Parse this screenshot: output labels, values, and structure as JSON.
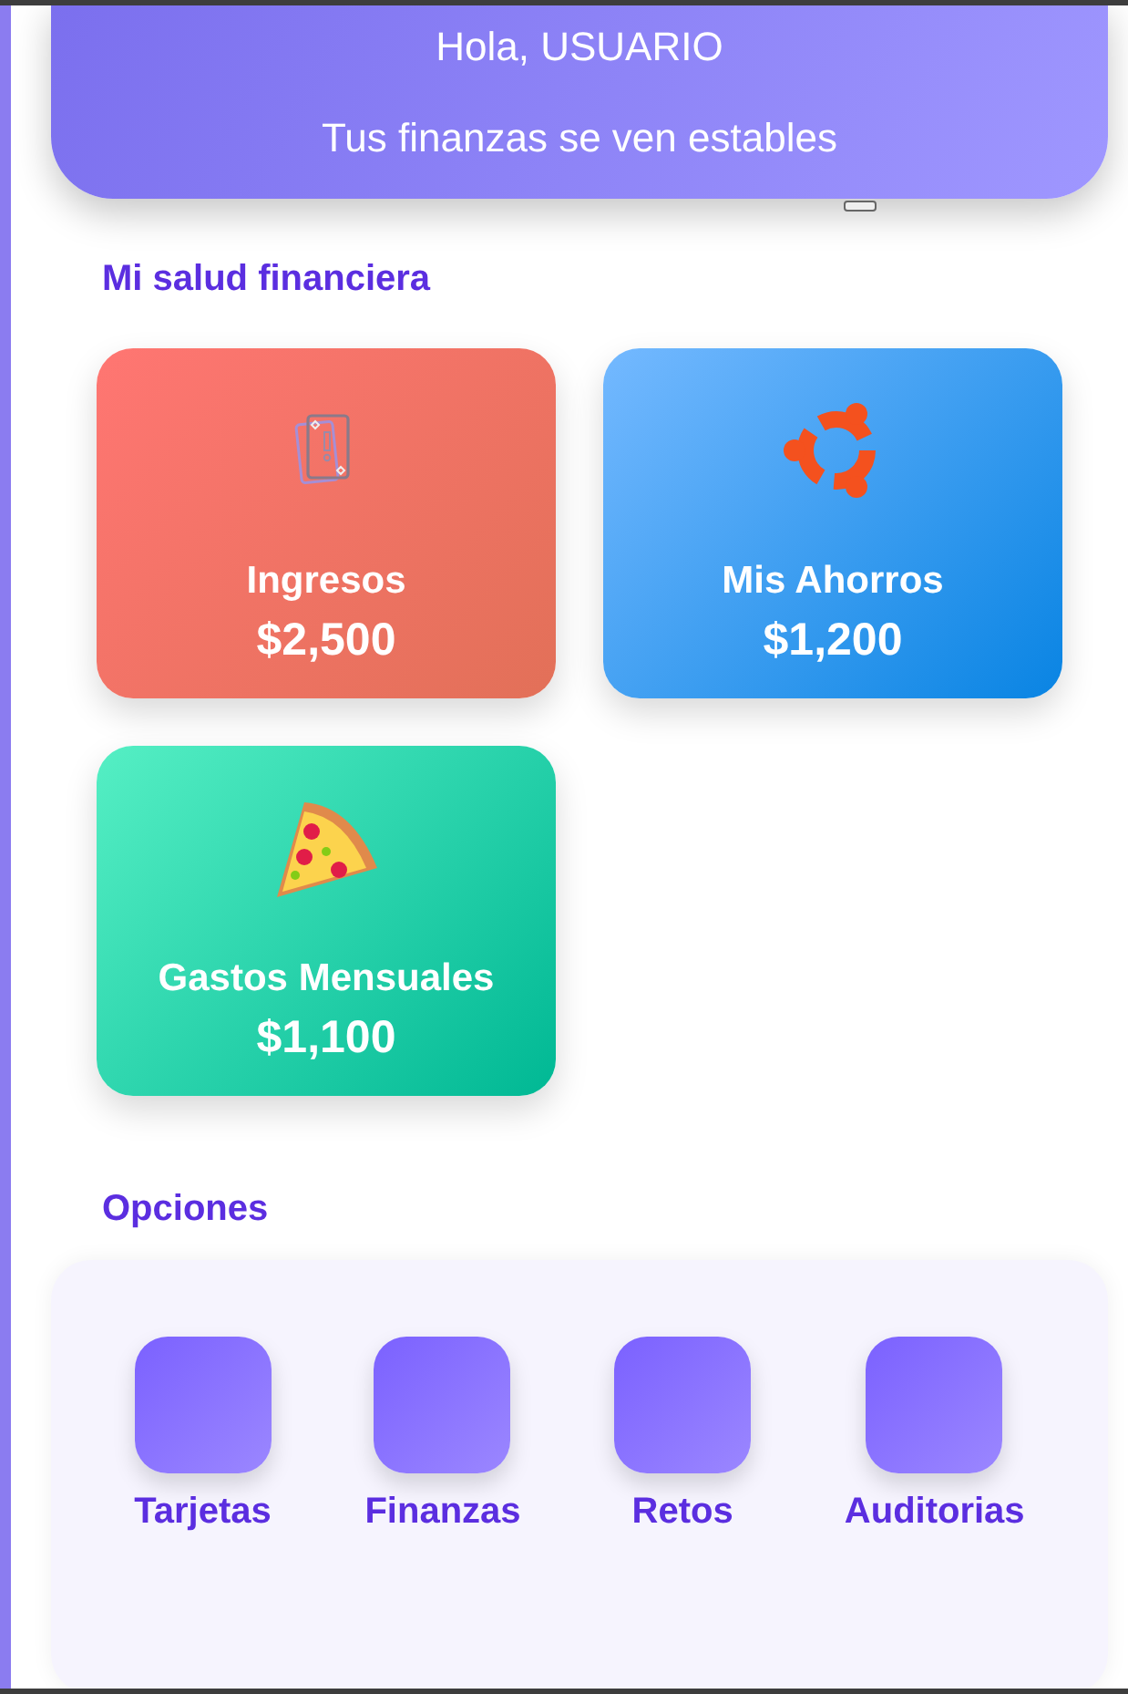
{
  "header": {
    "greeting": "Hola, USUARIO",
    "status": "Tus finanzas se ven estables"
  },
  "health": {
    "title": "Mi salud financiera",
    "cards": [
      {
        "kind": "cards",
        "label": "Ingresos",
        "amount": "$2,500"
      },
      {
        "kind": "ring",
        "label": "Mis Ahorros",
        "amount": "$1,200"
      },
      {
        "kind": "pizza",
        "label": "Gastos Mensuales",
        "amount": "$1,100"
      }
    ]
  },
  "options": {
    "title": "Opciones",
    "items": [
      {
        "label": "Tarjetas"
      },
      {
        "label": "Finanzas"
      },
      {
        "label": "Retos"
      },
      {
        "label": "Auditorias"
      }
    ]
  }
}
